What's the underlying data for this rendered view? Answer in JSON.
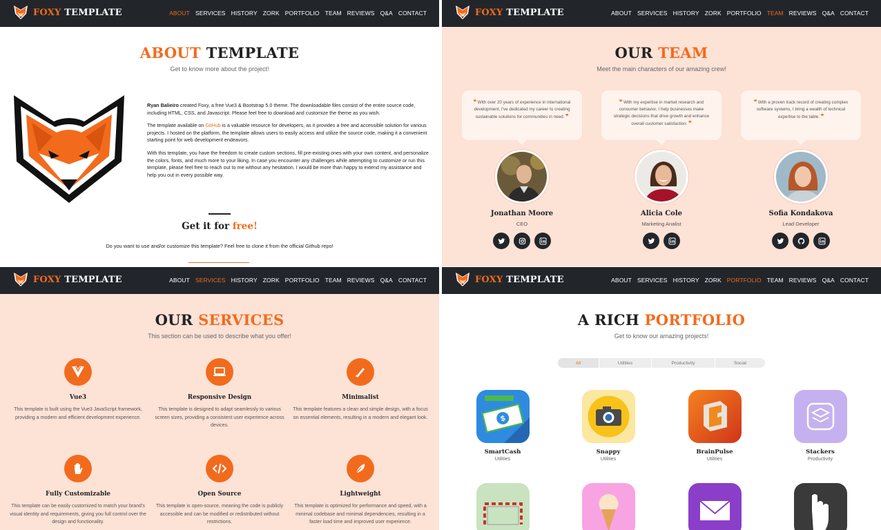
{
  "brand": {
    "part1": "FOXY",
    "part2": "TEMPLATE"
  },
  "nav_items": [
    "ABOUT",
    "SERVICES",
    "HISTORY",
    "ZORK",
    "PORTFOLIO",
    "TEAM",
    "REVIEWS",
    "Q&A",
    "CONTACT"
  ],
  "colors": {
    "accent": "#f26b1d",
    "navbar": "#22262b",
    "peach": "#fde2d6"
  },
  "about": {
    "active_nav": "ABOUT",
    "title_hl": "ABOUT",
    "title_rest": "TEMPLATE",
    "subtitle": "Get to know more about the project!",
    "p1_bold": "Ryan Balieiro",
    "p1_rest": " created Foxy, a free Vue3 & Bootstrap 5.0 theme. The downloadable files consist of the entire source code, including HTML, CSS, and Javascript. Please feel free to download and customize the theme as you wish.",
    "p2_before": "The template available on ",
    "p2_link": "GitHub",
    "p2_after": " is a valuable resource for developers, as it provides a free and accessible solution for various projects. I hosted on the platform, the template allows users to easily access and utilize the source code, making it a convenient starting point for web development endeavors.",
    "p3": "With this template, you have the freedom to create custom sections, fill pre-existing ones with your own content, and personalize the colors, fonts, and much more to your liking. In case you encounter any challenges while attempting to customize or run this template, please feel free to reach out to me without any hesitation. I would be more than happy to extend my assistance and help you out in every possible way.",
    "get_title": "Get it for ",
    "get_title_hl": "free!",
    "get_desc": "Do you want to use and/or customize this template? Feel free to clone it from the official Github repo!"
  },
  "team": {
    "active_nav": "TEAM",
    "title_plain": "OUR",
    "title_hl": "TEAM",
    "subtitle": "Meet the main characters of our amazing crew!",
    "members": [
      {
        "quote": "With over 20 years of experience in international development, I've dedicated my career to creating sustainable solutions for communities in need.",
        "name": "Jonathan Moore",
        "role": "CEO",
        "socials": [
          "twitter-icon",
          "instagram-icon",
          "linkedin-icon"
        ]
      },
      {
        "quote": "With my expertise in market research and consumer behavior, I help businesses make strategic decisions that drive growth and enhance overall customer satisfaction.",
        "name": "Alicia Cole",
        "role": "Marketing Analist",
        "socials": [
          "twitter-icon",
          "linkedin-icon"
        ]
      },
      {
        "quote": "With a proven track record of creating complex software systems, I bring a wealth of technical expertise to the table.",
        "name": "Sofia Kondakova",
        "role": "Lead Developer",
        "socials": [
          "twitter-icon",
          "github-icon",
          "linkedin-icon"
        ]
      }
    ]
  },
  "services": {
    "active_nav": "SERVICES",
    "title_plain": "OUR",
    "title_hl": "SERVICES",
    "subtitle": "This section can be used to describe what you offer!",
    "items": [
      {
        "title": "Vue3",
        "desc": "This template is built using the Vue3 JavaScript framework, providing a modern and efficient development experience.",
        "icon": "vue-icon"
      },
      {
        "title": "Responsive Design",
        "desc": "This template is designed to adapt seamlessly to various screen sizes, providing a consistent user experience across devices.",
        "icon": "laptop-icon"
      },
      {
        "title": "Minimalist",
        "desc": "This template features a clean and simple design, with a focus on essential elements, resulting in a modern and elegant look.",
        "icon": "pen-icon"
      },
      {
        "title": "Fully Customizable",
        "desc": "This template can be easily customized to match your brand's visual identity and requirements, giving you full control over the design and functionality.",
        "icon": "hand-icon"
      },
      {
        "title": "Open Source",
        "desc": "This template is open-source, meaning the code is publicly accessible and can be modified or redistributed without restrictions.",
        "icon": "code-icon"
      },
      {
        "title": "Lightweight",
        "desc": "This template is optimized for performance and speed, with a minimal codebase and minimal dependencies, resulting in a faster load time and improved user experience.",
        "icon": "feather-icon"
      }
    ]
  },
  "portfolio": {
    "active_nav": "PORTFOLIO",
    "title_plain": "A RICH",
    "title_hl": "PORTFOLIO",
    "subtitle": "Get to know our amazing projects!",
    "filters": [
      "All",
      "Utilities",
      "Productivity",
      "Social"
    ],
    "active_filter": "All",
    "apps": [
      {
        "name": "SmartCash",
        "category": "Utilities",
        "icon": "money-icon"
      },
      {
        "name": "Snappy",
        "category": "Utilities",
        "icon": "camera-icon"
      },
      {
        "name": "BrainPulse",
        "category": "Utilities",
        "icon": "puzzle-icon"
      },
      {
        "name": "Stackers",
        "category": "Productivity",
        "icon": "stack-icon"
      },
      {
        "name": "",
        "category": "",
        "icon": "goal-icon"
      },
      {
        "name": "",
        "category": "",
        "icon": "ice-cream-icon"
      },
      {
        "name": "",
        "category": "",
        "icon": "mail-icon"
      },
      {
        "name": "",
        "category": "",
        "icon": "hand-gesture-icon"
      }
    ]
  }
}
